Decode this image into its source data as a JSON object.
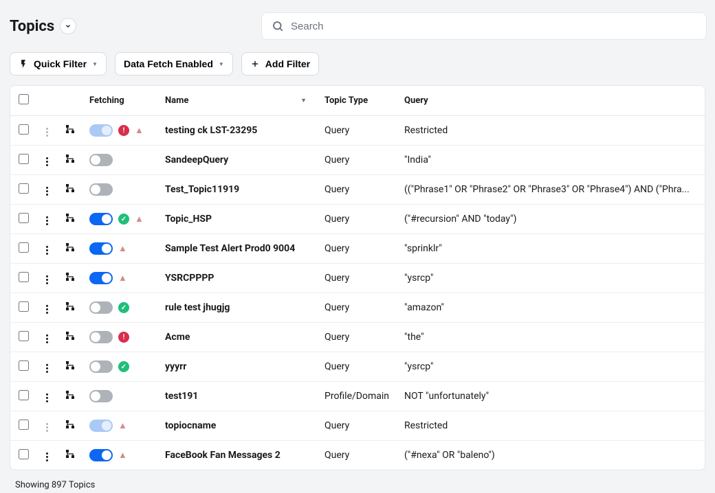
{
  "header": {
    "title": "Topics",
    "search_placeholder": "Search"
  },
  "filters": {
    "quick_filter": "Quick Filter",
    "data_fetch": "Data Fetch Enabled",
    "add_filter": "Add Filter"
  },
  "columns": {
    "fetching": "Fetching",
    "name": "Name",
    "topic_type": "Topic Type",
    "query": "Query"
  },
  "rows": [
    {
      "toggle": "on-disabled",
      "status": "error",
      "warn": true,
      "menuFaded": true,
      "name": "testing ck LST-23295",
      "type": "Query",
      "query": "Restricted"
    },
    {
      "toggle": "off",
      "status": "",
      "warn": false,
      "menuFaded": false,
      "name": "SandeepQuery",
      "type": "Query",
      "query": "\"India\""
    },
    {
      "toggle": "off",
      "status": "",
      "warn": false,
      "menuFaded": false,
      "name": "Test_Topic11919",
      "type": "Query",
      "query": "((\"Phrase1\" OR \"Phrase2\" OR \"Phrase3\" OR \"Phrase4\") AND (\"Phra..."
    },
    {
      "toggle": "on",
      "status": "ok",
      "warn": true,
      "menuFaded": false,
      "name": "Topic_HSP",
      "type": "Query",
      "query": "(\"#recursion\" AND \"today\")"
    },
    {
      "toggle": "on",
      "status": "",
      "warn": true,
      "menuFaded": false,
      "name": "Sample Test Alert Prod0 9004",
      "type": "Query",
      "query": "\"sprinklr\""
    },
    {
      "toggle": "on",
      "status": "",
      "warn": true,
      "menuFaded": false,
      "name": "YSRCPPPP",
      "type": "Query",
      "query": "\"ysrcp\""
    },
    {
      "toggle": "off",
      "status": "ok",
      "warn": false,
      "menuFaded": false,
      "name": "rule test jhugjg",
      "type": "Query",
      "query": "\"amazon\""
    },
    {
      "toggle": "off",
      "status": "error",
      "warn": false,
      "menuFaded": false,
      "name": "Acme",
      "type": "Query",
      "query": "\"the\""
    },
    {
      "toggle": "off",
      "status": "ok",
      "warn": false,
      "menuFaded": false,
      "name": "yyyrr",
      "type": "Query",
      "query": "\"ysrcp\""
    },
    {
      "toggle": "off",
      "status": "",
      "warn": false,
      "menuFaded": false,
      "name": "test191",
      "type": "Profile/Domain",
      "query": "NOT \"unfortunately\""
    },
    {
      "toggle": "on-disabled",
      "status": "",
      "warn": true,
      "menuFaded": true,
      "name": "topiocname",
      "type": "Query",
      "query": "Restricted"
    },
    {
      "toggle": "on",
      "status": "",
      "warn": true,
      "menuFaded": false,
      "name": "FaceBook Fan Messages 2",
      "type": "Query",
      "query": "(\"#nexa\" OR \"baleno\")"
    }
  ],
  "footer": {
    "status": "Showing 897 Topics"
  }
}
